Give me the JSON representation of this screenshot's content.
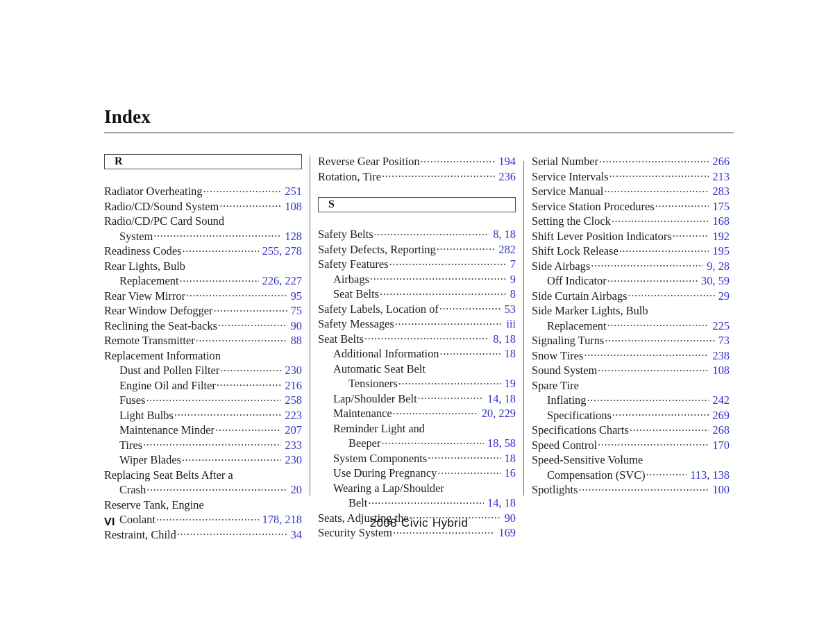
{
  "header": {
    "title": "Index"
  },
  "footer": {
    "page_number": "VI",
    "model_year": "2008",
    "model_name": "Civic",
    "model_trim": "Hybrid"
  },
  "colors": {
    "page_reference": "#3333cc",
    "text": "#1c1c1c",
    "rule": "#2b2b2b"
  },
  "columns": [
    {
      "letter_heading": "R",
      "entries": [
        {
          "label": "Radiator Overheating",
          "pages": "251",
          "level": 0
        },
        {
          "label": "Radio/CD/Sound System",
          "pages": "108",
          "level": 0
        },
        {
          "label": "Radio/CD/PC Card Sound",
          "pages": "",
          "level": 0
        },
        {
          "label": "System",
          "pages": "128",
          "level": 1
        },
        {
          "label": "Readiness Codes",
          "pages": "255, 278",
          "level": 0
        },
        {
          "label": "Rear Lights, Bulb",
          "pages": "",
          "level": 0
        },
        {
          "label": "Replacement",
          "pages": "226, 227",
          "level": 1
        },
        {
          "label": "Rear View Mirror",
          "pages": "95",
          "level": 0
        },
        {
          "label": "Rear Window Defogger",
          "pages": "75",
          "level": 0
        },
        {
          "label": "Reclining the Seat-backs",
          "pages": "90",
          "level": 0
        },
        {
          "label": "Remote Transmitter",
          "pages": "88",
          "level": 0
        },
        {
          "label": "Replacement Information",
          "pages": "",
          "level": 0
        },
        {
          "label": "Dust and Pollen Filter",
          "pages": "230",
          "level": 1
        },
        {
          "label": "Engine Oil and Filter",
          "pages": "216",
          "level": 1
        },
        {
          "label": "Fuses",
          "pages": "258",
          "level": 1
        },
        {
          "label": "Light Bulbs",
          "pages": "223",
          "level": 1
        },
        {
          "label": "Maintenance Minder",
          "pages": "207",
          "level": 1
        },
        {
          "label": "Tires",
          "pages": "233",
          "level": 1
        },
        {
          "label": "Wiper Blades",
          "pages": "230",
          "level": 1
        },
        {
          "label": "Replacing Seat Belts After a",
          "pages": "",
          "level": 0
        },
        {
          "label": "Crash",
          "pages": "20",
          "level": 1
        },
        {
          "label": "Reserve Tank, Engine",
          "pages": "",
          "level": 0
        },
        {
          "label": "Coolant",
          "pages": "178, 218",
          "level": 1
        },
        {
          "label": "Restraint, Child",
          "pages": "34",
          "level": 0
        }
      ]
    },
    {
      "letter_heading": "S",
      "pre_entries": [
        {
          "label": "Reverse Gear Position",
          "pages": "194",
          "level": 0
        },
        {
          "label": "Rotation, Tire",
          "pages": "236",
          "level": 0
        }
      ],
      "entries": [
        {
          "label": "Safety Belts",
          "pages": "8, 18",
          "level": 0
        },
        {
          "label": "Safety Defects, Reporting",
          "pages": "282",
          "level": 0
        },
        {
          "label": "Safety Features",
          "pages": "7",
          "level": 0
        },
        {
          "label": "Airbags",
          "pages": "9",
          "level": 1
        },
        {
          "label": "Seat Belts",
          "pages": "8",
          "level": 1
        },
        {
          "label": "Safety Labels, Location of",
          "pages": "53",
          "level": 0
        },
        {
          "label": "Safety Messages",
          "pages": "iii",
          "level": 0
        },
        {
          "label": "Seat Belts",
          "pages": "8, 18",
          "level": 0
        },
        {
          "label": "Additional Information",
          "pages": "18",
          "level": 1
        },
        {
          "label": "Automatic Seat Belt",
          "pages": "",
          "level": 1
        },
        {
          "label": "Tensioners",
          "pages": "19",
          "level": 2
        },
        {
          "label": "Lap/Shoulder Belt",
          "pages": "14, 18",
          "level": 1
        },
        {
          "label": "Maintenance",
          "pages": "20, 229",
          "level": 1
        },
        {
          "label": "Reminder Light and",
          "pages": "",
          "level": 1
        },
        {
          "label": "Beeper",
          "pages": "18, 58",
          "level": 2
        },
        {
          "label": "System Components",
          "pages": "18",
          "level": 1
        },
        {
          "label": "Use During Pregnancy",
          "pages": "16",
          "level": 1
        },
        {
          "label": "Wearing a Lap/Shoulder",
          "pages": "",
          "level": 1
        },
        {
          "label": "Belt",
          "pages": "14, 18",
          "level": 2
        },
        {
          "label": "Seats, Adjusting the",
          "pages": "90",
          "level": 0
        },
        {
          "label": "Security System",
          "pages": "169",
          "level": 0
        }
      ]
    },
    {
      "letter_heading": "",
      "entries": [
        {
          "label": "Serial Number",
          "pages": "266",
          "level": 0
        },
        {
          "label": "Service Intervals",
          "pages": "213",
          "level": 0
        },
        {
          "label": "Service Manual",
          "pages": "283",
          "level": 0
        },
        {
          "label": "Service Station Procedures",
          "pages": "175",
          "level": 0
        },
        {
          "label": "Setting the Clock",
          "pages": "168",
          "level": 0
        },
        {
          "label": "Shift Lever Position Indicators",
          "pages": "192",
          "level": 0
        },
        {
          "label": "Shift Lock Release",
          "pages": "195",
          "level": 0
        },
        {
          "label": "Side Airbags",
          "pages": "9, 28",
          "level": 0
        },
        {
          "label": "Off Indicator",
          "pages": "30, 59",
          "level": 1
        },
        {
          "label": "Side Curtain Airbags",
          "pages": "29",
          "level": 0
        },
        {
          "label": "Side Marker Lights, Bulb",
          "pages": "",
          "level": 0
        },
        {
          "label": "Replacement",
          "pages": "225",
          "level": 1
        },
        {
          "label": "Signaling Turns",
          "pages": "73",
          "level": 0
        },
        {
          "label": "Snow Tires",
          "pages": "238",
          "level": 0
        },
        {
          "label": "Sound System",
          "pages": "108",
          "level": 0
        },
        {
          "label": "Spare Tire",
          "pages": "",
          "level": 0
        },
        {
          "label": "Inflating",
          "pages": "242",
          "level": 1
        },
        {
          "label": "Specifications",
          "pages": "269",
          "level": 1
        },
        {
          "label": "Specifications Charts",
          "pages": "268",
          "level": 0
        },
        {
          "label": "Speed Control",
          "pages": "170",
          "level": 0
        },
        {
          "label": "Speed-Sensitive Volume",
          "pages": "",
          "level": 0
        },
        {
          "label": "Compensation (SVC)",
          "pages": "113, 138",
          "level": 1
        },
        {
          "label": "Spotlights",
          "pages": "100",
          "level": 0
        }
      ]
    }
  ]
}
